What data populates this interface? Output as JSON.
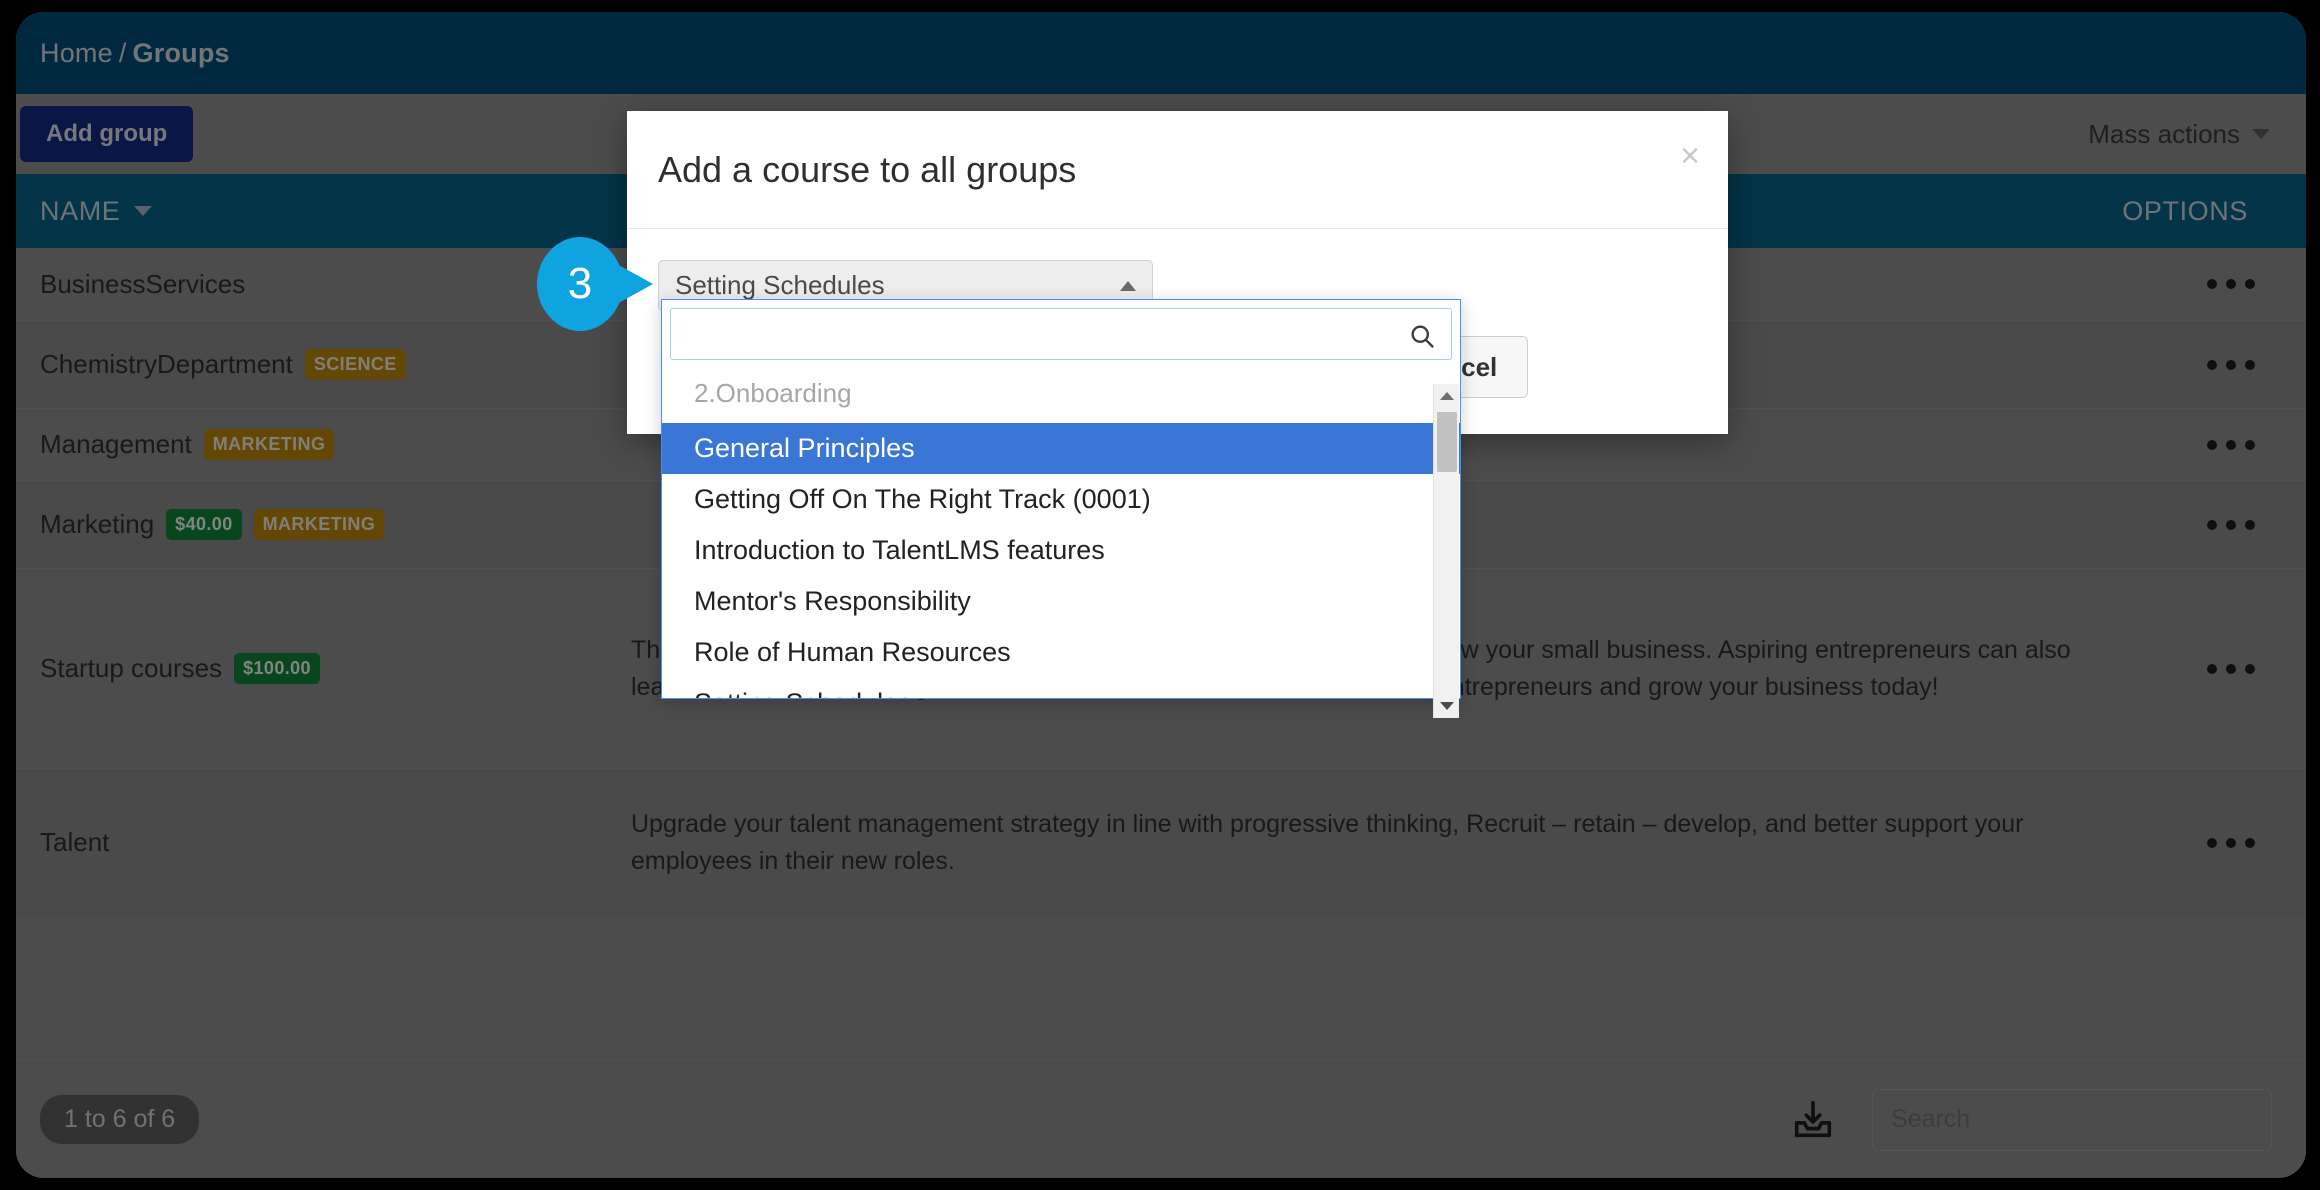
{
  "header": {
    "breadcrumb_home": "Home",
    "breadcrumb_sep": "/",
    "breadcrumb_current": "Groups"
  },
  "toolbar": {
    "add_group_label": "Add group",
    "mass_actions_label": "Mass actions"
  },
  "table": {
    "col_name": "NAME",
    "col_options": "OPTIONS",
    "rows": [
      {
        "name": "BusinessServices",
        "badges": [],
        "description": ""
      },
      {
        "name": "ChemistryDepartment",
        "badges": [
          {
            "text": "SCIENCE",
            "kind": "tag"
          }
        ],
        "description": ""
      },
      {
        "name": "Management",
        "badges": [
          {
            "text": "MARKETING",
            "kind": "tag"
          }
        ],
        "description": ""
      },
      {
        "name": "Marketing",
        "badges": [
          {
            "text": "$40.00",
            "kind": "price"
          },
          {
            "text": "MARKETING",
            "kind": "tag"
          }
        ],
        "description": ""
      },
      {
        "name": "Startup courses",
        "badges": [
          {
            "text": "$100.00",
            "kind": "price"
          }
        ],
        "description": "These free online entrepreneurship courses can help you start, run and grow your small business. Aspiring entrepreneurs can also learn all about kick-starting a business. Learn from successful real-world entrepreneurs and grow your business today!"
      },
      {
        "name": "Talent",
        "badges": [],
        "description": "Upgrade your talent management strategy in line with progressive thinking, Recruit – retain – develop, and better support your employees in their new roles."
      }
    ]
  },
  "footer": {
    "pager_count": "1 to 6 of 6",
    "search_placeholder": "Search",
    "download_icon": "download-icon"
  },
  "modal": {
    "title": "Add a course to all groups",
    "close_label": "×",
    "select_value": "Setting Schedules",
    "add_label": "",
    "cancel_label": "Cancel"
  },
  "dropdown": {
    "search_value": "",
    "group_label": "2.Onboarding",
    "items": [
      {
        "label": "General Principles",
        "selected": true
      },
      {
        "label": "Getting Off On The Right Track (0001)",
        "selected": false
      },
      {
        "label": "Introduction to TalentLMS features",
        "selected": false
      },
      {
        "label": "Mentor's Responsibility",
        "selected": false
      },
      {
        "label": "Role of Human Resources",
        "selected": false
      },
      {
        "label": "Setting Schedules",
        "selected": false
      }
    ]
  },
  "callout": {
    "number": "3"
  },
  "colors": {
    "header_blue": "#014a71",
    "table_head_blue": "#075f82",
    "add_group_blue": "#13287e",
    "selected_item_blue": "#3a76d6",
    "price_green": "#118036",
    "tag_gold": "#b58209",
    "callout_cyan": "#0fa3e0",
    "add_button_green": "#0b8a37"
  }
}
